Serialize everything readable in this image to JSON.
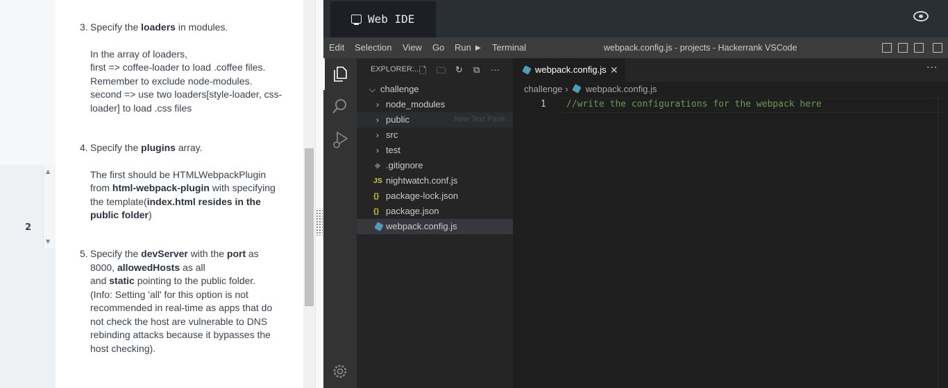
{
  "instructions": {
    "gutter_number": "2",
    "step3": {
      "num": "3.",
      "pre": "Specify the ",
      "bold": "loaders",
      "post": " in modules.",
      "lines": [
        "In the array of loaders,",
        "first => coffee-loader to load .coffee files.",
        "Remember to exclude node-modules.",
        "second => use two loaders[style-loader, css-",
        "loader] to load .css files"
      ]
    },
    "step4": {
      "num": "4.",
      "pre": "Specify the ",
      "bold": "plugins",
      "post": " array.",
      "p1": "The first should be HTMLWebpackPlugin",
      "p2_pre": "from ",
      "p2_bold": "html-webpack-plugin",
      "p2_post": " with specifying",
      "p3_pre": "the template(",
      "p3_bold": "index.html resides in the",
      "p4_bold": "public folder",
      "p4_post": ")"
    },
    "step5": {
      "num": "5.",
      "pre": "Specify the ",
      "b1": "devServer",
      "mid": " with the ",
      "b2": "port",
      "post": " as",
      "l2_pre": "8000, ",
      "l2_bold": "allowedHosts",
      "l2_post": " as all",
      "l3_pre": "and ",
      "l3_bold": "static",
      "l3_post": " pointing to the public folder.",
      "rest": [
        "(Info: Setting 'all' for this option is not",
        "recommended in real-time as apps that do",
        "not check the host are vulnerable to DNS",
        "rebinding attacks because it bypasses the",
        "host checking)."
      ]
    }
  },
  "ide": {
    "tab_label": "Web IDE",
    "menu": [
      "Edit",
      "Selection",
      "View",
      "Go",
      "Run",
      "Terminal"
    ],
    "window_title": "webpack.config.js - projects - Hackerrank VSCode",
    "explorer": {
      "title": "EXPLORER:...",
      "root": "challenge",
      "items": [
        {
          "label": "node_modules",
          "kind": "folder"
        },
        {
          "label": "public",
          "kind": "folder"
        },
        {
          "label": "src",
          "kind": "folder"
        },
        {
          "label": "test",
          "kind": "folder"
        },
        {
          "label": ".gitignore",
          "kind": "file",
          "icon": "◆"
        },
        {
          "label": "nightwatch.conf.js",
          "kind": "file",
          "icon": "JS"
        },
        {
          "label": "package-lock.json",
          "kind": "file",
          "icon": "{}"
        },
        {
          "label": "package.json",
          "kind": "file",
          "icon": "{}"
        },
        {
          "label": "webpack.config.js",
          "kind": "file",
          "icon": "cube"
        }
      ],
      "selected_item": "webpack.config.js",
      "drag_ghost": "New Text Pane"
    },
    "editor": {
      "tab": "webpack.config.js",
      "breadcrumb": [
        "challenge",
        "webpack.config.js"
      ],
      "line_number": "1",
      "code": "//write the configurations for the webpack here"
    },
    "colors": {
      "accent": "#519aba",
      "comment": "#6a9955",
      "json_icon": "#cbcb41",
      "js_icon": "#cbcb41"
    }
  }
}
